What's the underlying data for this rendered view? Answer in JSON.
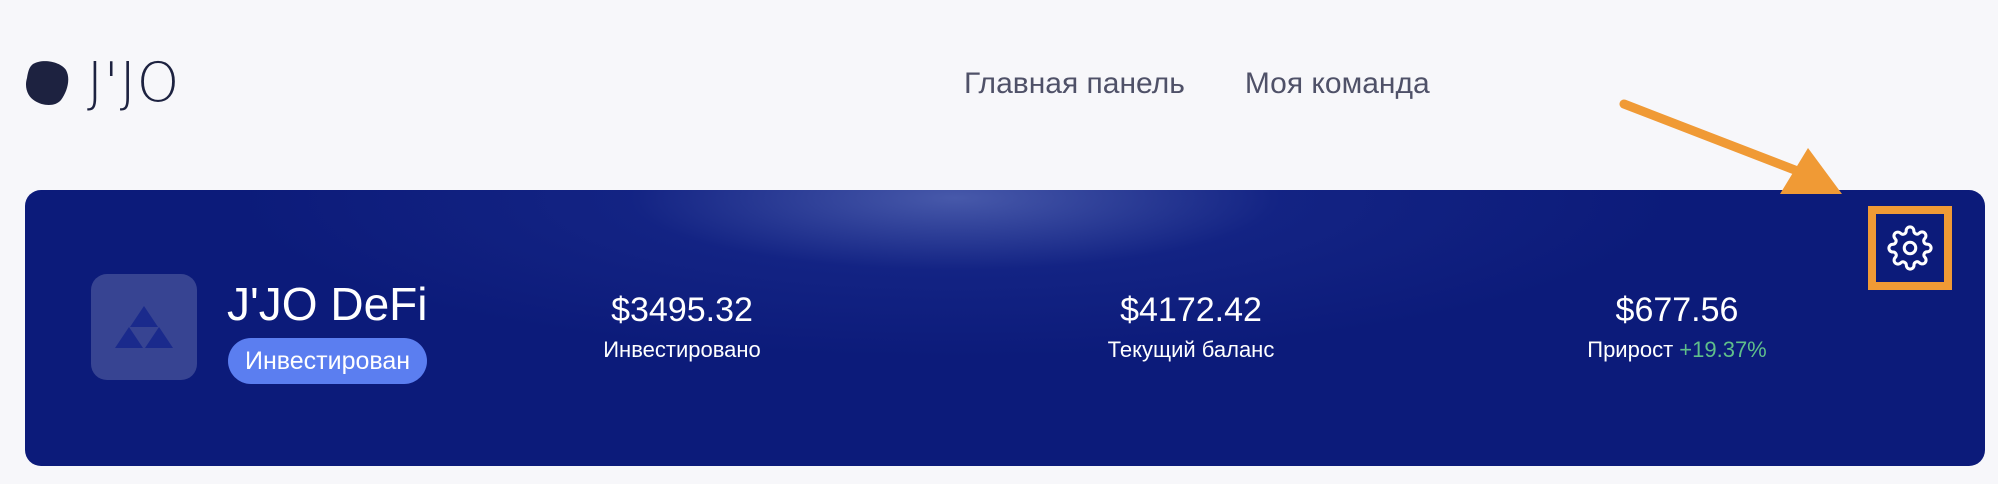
{
  "header": {
    "logo_text": "J'JO",
    "logo_icon": "blob-logo-icon",
    "nav": [
      {
        "label": "Главная панель"
      },
      {
        "label": "Моя команда"
      }
    ]
  },
  "card": {
    "project_icon": "triforce-icon",
    "project_name": "J'JO DeFi",
    "status": "Инвестирован",
    "stats": [
      {
        "value": "$3495.32",
        "label": "Инвестировано"
      },
      {
        "value": "$4172.42",
        "label": "Текущий баланс"
      },
      {
        "value": "$677.56",
        "label": "Прирост",
        "extra": "+19.37%"
      }
    ],
    "settings_icon": "gear-icon"
  },
  "annotation": {
    "arrow_color": "#f09a35",
    "highlight_color": "#f09a35"
  },
  "colors": {
    "card_bg": "#0c1b7a",
    "badge_bg": "#5b7ef0",
    "growth_positive": "#5fbf8a",
    "page_bg": "#f7f7fa"
  }
}
